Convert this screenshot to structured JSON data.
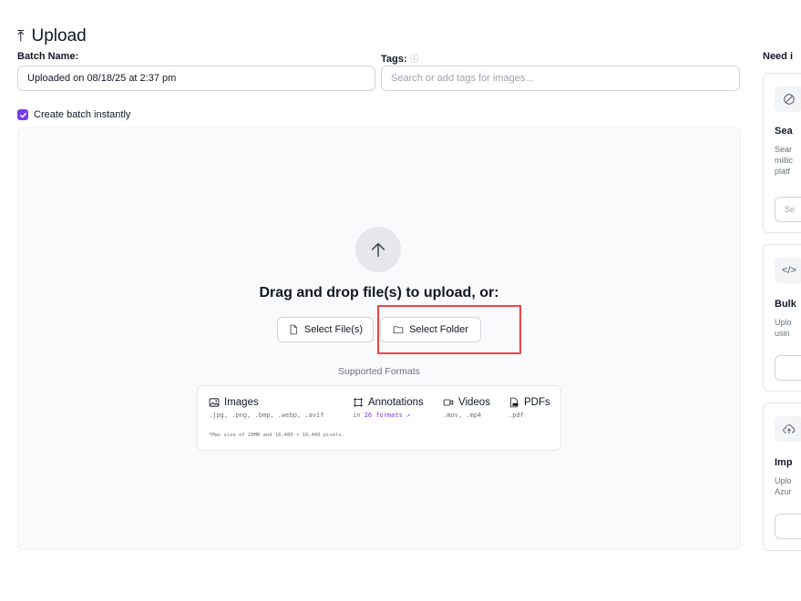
{
  "header": {
    "title": "Upload",
    "icon": "upload-icon"
  },
  "form": {
    "batch_label": "Batch Name:",
    "batch_value": "Uploaded on 08/18/25 at 2:37 pm",
    "tags_label": "Tags:",
    "tags_placeholder": "Search or add tags for images...",
    "create_batch_label": "Create batch instantly",
    "create_batch_checked": true
  },
  "dropzone": {
    "prompt": "Drag and drop file(s) to upload, or:",
    "select_files": "Select File(s)",
    "select_folder": "Select Folder",
    "supported_title": "Supported Formats",
    "formats": {
      "images": {
        "label": "Images",
        "sub": ".jpg, .png, .bmp, .webp, .avif"
      },
      "annotations": {
        "label": "Annotations",
        "sub_prefix": "in",
        "sub_link": "26 formats ↗"
      },
      "videos": {
        "label": "Videos",
        "sub": ".mov, .mp4"
      },
      "pdfs": {
        "label": "PDFs",
        "sub": ".pdf"
      }
    },
    "note": "*Max size of 20MB and 16,400 × 16,400 pixels."
  },
  "sidebar": {
    "title": "Need i",
    "cards": [
      {
        "icon": "compass-icon",
        "title": "Sea",
        "desc": [
          "Sear",
          "millic",
          "platf"
        ],
        "button": "Se"
      },
      {
        "icon": "code-icon",
        "icon_text": "</>",
        "title": "Bulk",
        "desc": [
          "Uplo",
          "usin"
        ],
        "button": ""
      },
      {
        "icon": "cloud-upload-icon",
        "title": "Imp",
        "desc": [
          "Uplo",
          "Azur"
        ],
        "button": ""
      }
    ]
  },
  "colors": {
    "accent": "#7c3aed",
    "highlight": "#ef4444",
    "dropzone_bg": "#f9fafb"
  }
}
